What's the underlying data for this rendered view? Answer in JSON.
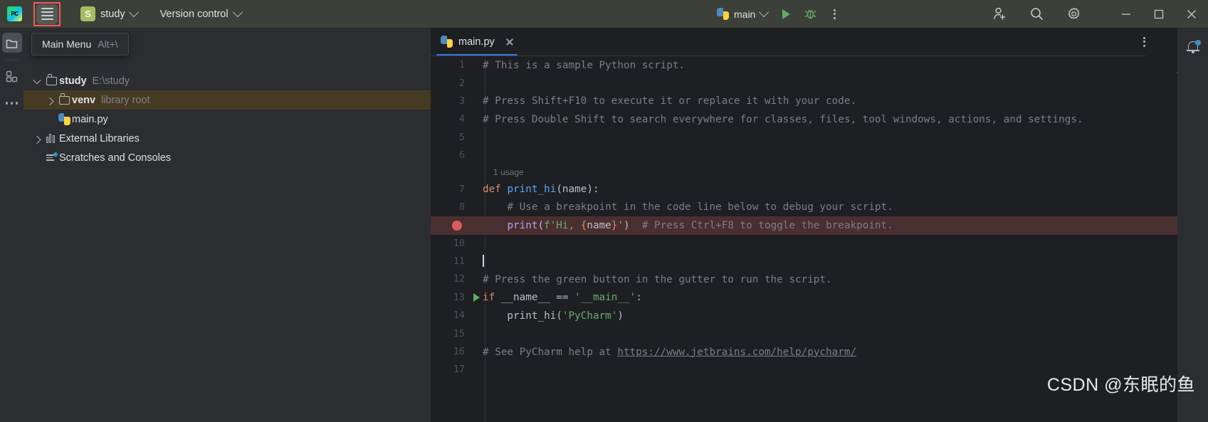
{
  "titlebar": {
    "logo_alt": "PyCharm",
    "menu_button_icon": "hamburger-menu-icon",
    "project": {
      "badge": "S",
      "name": "study"
    },
    "version_control": "Version control",
    "run_config": {
      "name": "main"
    },
    "actions": {
      "run": "Run",
      "debug": "Debug",
      "more": "More Actions",
      "add_user": "Add Collaborator",
      "search": "Search Everywhere",
      "settings": "Settings"
    },
    "window": {
      "minimize": "Minimize",
      "maximize": "Maximize",
      "close": "Close"
    }
  },
  "tooltip": {
    "label": "Main Menu",
    "shortcut": "Alt+\\"
  },
  "left_rail": {
    "items": [
      {
        "icon": "project-folder-icon",
        "name": "project-tool-window",
        "active": true
      },
      {
        "icon": "structure-grid-icon",
        "name": "structure-tool-window",
        "active": false
      },
      {
        "icon": "more-dots-icon",
        "name": "more-tool-windows",
        "active": false
      }
    ]
  },
  "project_tree": {
    "rows": [
      {
        "indent": 0,
        "arrow": "down",
        "icon": "folder-icon",
        "name": "study",
        "sub": "E:\\study",
        "bold": true,
        "selected": false
      },
      {
        "indent": 1,
        "arrow": "right",
        "icon": "folder-icon",
        "name": "venv",
        "sub": "library root",
        "bold": true,
        "selected": true
      },
      {
        "indent": 1,
        "arrow": "none",
        "icon": "python-icon",
        "name": "main.py",
        "sub": "",
        "bold": false,
        "selected": false
      },
      {
        "indent": 0,
        "arrow": "right",
        "icon": "libraries-icon",
        "name": "External Libraries",
        "sub": "",
        "bold": false,
        "selected": false
      },
      {
        "indent": 0,
        "arrow": "none",
        "icon": "scratches-icon",
        "name": "Scratches and Consoles",
        "sub": "",
        "bold": false,
        "selected": false
      }
    ]
  },
  "editor": {
    "tabs": [
      {
        "label": "main.py",
        "icon": "python-icon",
        "active": true,
        "close_icon": "close-icon"
      }
    ],
    "options_icon": "more-vertical-icon",
    "inspection_status": "ok",
    "inlay_hints": [
      {
        "after_line": 6,
        "text": "1 usage"
      }
    ],
    "lines": [
      {
        "n": 1,
        "gutter": "none",
        "tokens": [
          {
            "t": "# This is a sample Python script.",
            "c": "c-comment"
          }
        ]
      },
      {
        "n": 2,
        "gutter": "none",
        "tokens": []
      },
      {
        "n": 3,
        "gutter": "none",
        "tokens": [
          {
            "t": "# Press Shift+F10 to execute it or replace it with your code.",
            "c": "c-comment"
          }
        ]
      },
      {
        "n": 4,
        "gutter": "none",
        "tokens": [
          {
            "t": "# Press Double Shift to search everywhere for classes, files, tool windows, actions, and settings.",
            "c": "c-comment"
          }
        ]
      },
      {
        "n": 5,
        "gutter": "none",
        "tokens": []
      },
      {
        "n": 6,
        "gutter": "none",
        "tokens": []
      },
      {
        "n": 7,
        "gutter": "none",
        "tokens": [
          {
            "t": "def ",
            "c": "c-kw"
          },
          {
            "t": "print_hi",
            "c": "c-func"
          },
          {
            "t": "(name):",
            "c": "c-def"
          }
        ]
      },
      {
        "n": 8,
        "gutter": "none",
        "tokens": [
          {
            "t": "    # Use a breakpoint in the code line below to debug your script.",
            "c": "c-comment"
          }
        ]
      },
      {
        "n": 9,
        "gutter": "breakpoint",
        "highlight": true,
        "tokens": [
          {
            "t": "    ",
            "c": "c-def"
          },
          {
            "t": "print",
            "c": "c-print"
          },
          {
            "t": "(",
            "c": "c-def"
          },
          {
            "t": "f'Hi, ",
            "c": "c-str"
          },
          {
            "t": "{",
            "c": "c-brace"
          },
          {
            "t": "name",
            "c": "c-def"
          },
          {
            "t": "}",
            "c": "c-brace"
          },
          {
            "t": "'",
            "c": "c-str"
          },
          {
            "t": ")",
            "c": "c-def"
          },
          {
            "t": "  # Press Ctrl+F8 to toggle the breakpoint.",
            "c": "c-comment"
          }
        ]
      },
      {
        "n": 10,
        "gutter": "none",
        "tokens": []
      },
      {
        "n": 11,
        "gutter": "none",
        "caret": true,
        "tokens": []
      },
      {
        "n": 12,
        "gutter": "none",
        "tokens": [
          {
            "t": "# Press the green button in the gutter to run the script.",
            "c": "c-comment"
          }
        ]
      },
      {
        "n": 13,
        "gutter": "run",
        "tokens": [
          {
            "t": "if ",
            "c": "c-kw"
          },
          {
            "t": "__name__ == ",
            "c": "c-def"
          },
          {
            "t": "'__main__'",
            "c": "c-str"
          },
          {
            "t": ":",
            "c": "c-def"
          }
        ]
      },
      {
        "n": 14,
        "gutter": "none",
        "tokens": [
          {
            "t": "    print_hi(",
            "c": "c-def"
          },
          {
            "t": "'PyCharm'",
            "c": "c-str"
          },
          {
            "t": ")",
            "c": "c-def"
          }
        ]
      },
      {
        "n": 15,
        "gutter": "none",
        "tokens": []
      },
      {
        "n": 16,
        "gutter": "none",
        "tokens": [
          {
            "t": "# See PyCharm help at ",
            "c": "c-comment"
          },
          {
            "t": "https://www.jetbrains.com/help/pycharm/",
            "c": "c-link"
          }
        ]
      },
      {
        "n": 17,
        "gutter": "none",
        "tokens": []
      }
    ]
  },
  "right_rail": {
    "notifications_icon": "bell-icon",
    "has_unread": true
  },
  "watermark": "CSDN @东眠的鱼",
  "colors": {
    "titlebar_bg": "#3d4038",
    "panel_bg": "#2b2d30",
    "editor_bg": "#1e1f22",
    "accent_blue": "#3574f0",
    "selection_brown": "#463a23",
    "breakpoint_red": "#db5c5c",
    "breakpoint_line_bg": "#4a2f31",
    "run_green": "#5fad65",
    "tooltip_border": "#f05b5b"
  }
}
